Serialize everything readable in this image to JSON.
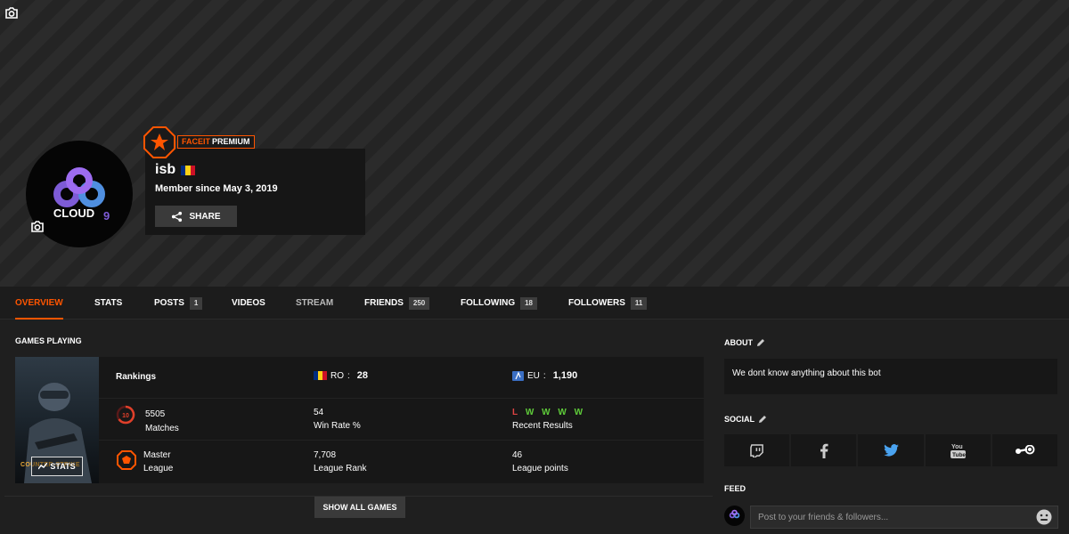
{
  "profile": {
    "username": "isb",
    "member_since": "Member since May 3, 2019",
    "share_label": "SHARE",
    "premium_brand": "FACEIT",
    "premium_tier": "PREMIUM",
    "avatar_text": "CLOUD",
    "flag_colors": [
      "#002b7f",
      "#fcd116",
      "#ce1126"
    ]
  },
  "tabs": [
    {
      "label": "OVERVIEW",
      "active": true
    },
    {
      "label": "STATS"
    },
    {
      "label": "POSTS",
      "count": "1"
    },
    {
      "label": "VIDEOS"
    },
    {
      "label": "STREAM"
    },
    {
      "label": "FRIENDS",
      "count": "250"
    },
    {
      "label": "FOLLOWING",
      "count": "18"
    },
    {
      "label": "FOLLOWERS",
      "count": "11"
    }
  ],
  "games": {
    "title": "GAMES PLAYING",
    "show_all_label": "SHOW ALL GAMES",
    "cover": {
      "title_text": "COUNTER-STRIKE",
      "stats_label": "STATS"
    },
    "rankings_label": "Rankings",
    "country_rank": {
      "region": "RO",
      "value": "28"
    },
    "region_rank": {
      "region": "EU",
      "value": "1,190"
    },
    "skill_level": "10",
    "elo": "5505",
    "matches_label": "Matches",
    "win_rate": {
      "value": "54",
      "label": "Win Rate %"
    },
    "recent_results": {
      "values": [
        "L",
        "W",
        "W",
        "W",
        "W"
      ],
      "label": "Recent Results"
    },
    "league": {
      "value": "Master",
      "label": "League"
    },
    "league_rank": {
      "value": "7,708",
      "label": "League Rank"
    },
    "league_points": {
      "value": "46",
      "label": "League points"
    }
  },
  "about": {
    "title": "ABOUT",
    "text": "We dont know anything about this bot"
  },
  "social": {
    "title": "SOCIAL",
    "items": [
      "twitch-icon",
      "facebook-icon",
      "twitter-icon",
      "youtube-icon",
      "steam-icon"
    ]
  },
  "feed": {
    "title": "FEED",
    "placeholder": "Post to your friends & followers..."
  },
  "colors": {
    "accent": "#ff5500",
    "win": "#5fcc3a",
    "loss": "#e04444"
  }
}
